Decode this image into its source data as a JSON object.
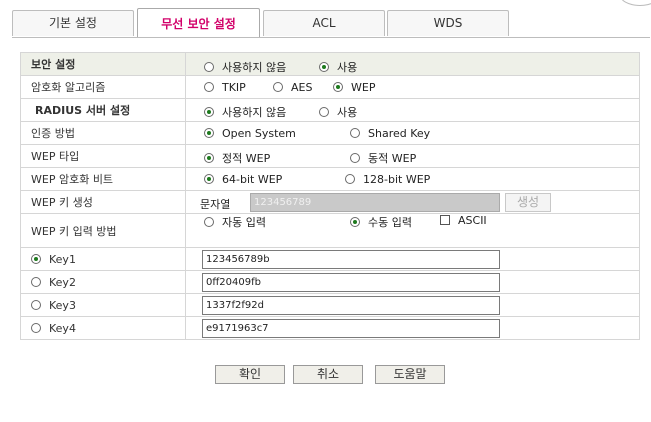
{
  "tabs": [
    {
      "label": "기본 설정"
    },
    {
      "label": "무선 보안 설정"
    },
    {
      "label": "ACL"
    },
    {
      "label": "WDS"
    }
  ],
  "security": {
    "label": "보안 설정",
    "opt_off": "사용하지 않음",
    "opt_on": "사용"
  },
  "encryption": {
    "label": "암호화 알고리즘",
    "tkip": "TKIP",
    "aes": "AES",
    "wep": "WEP"
  },
  "radius": {
    "label": "RADIUS 서버 설정",
    "opt_off": "사용하지 않음",
    "opt_on": "사용"
  },
  "auth": {
    "label": "인증 방법",
    "open": "Open System",
    "shared": "Shared Key"
  },
  "wep_type": {
    "label": "WEP 타입",
    "static": "정적 WEP",
    "dynamic": "동적 WEP"
  },
  "wep_bits": {
    "label": "WEP 암호화 비트",
    "bit64": "64-bit WEP",
    "bit128": "128-bit WEP"
  },
  "wep_gen": {
    "label": "WEP 키 생성",
    "passphrase_label": "문자열",
    "passphrase_value": "123456789",
    "generate_button": "생성"
  },
  "wep_input": {
    "label": "WEP 키 입력 방법",
    "auto": "자동 입력",
    "manual": "수동 입력",
    "ascii": "ASCII"
  },
  "keys": [
    {
      "label": "Key1",
      "value": "123456789b"
    },
    {
      "label": "Key2",
      "value": "0ff20409fb"
    },
    {
      "label": "Key3",
      "value": "1337f2f92d"
    },
    {
      "label": "Key4",
      "value": "e9171963c7"
    }
  ],
  "buttons": {
    "ok": "확인",
    "cancel": "취소",
    "help": "도움말"
  },
  "colors": {
    "active_tab_text": "#d2006a",
    "header_bg": "#eef0e8",
    "radio_dot": "#1e7a1e"
  }
}
